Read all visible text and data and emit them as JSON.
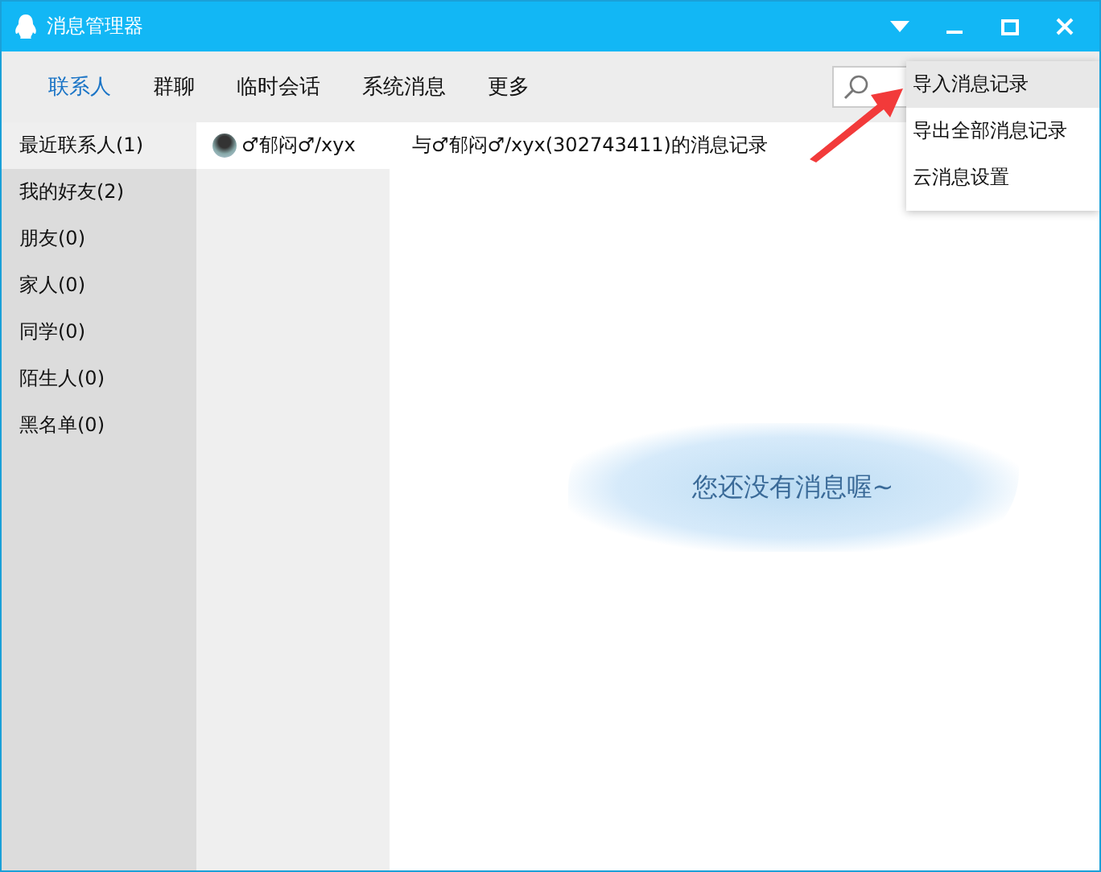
{
  "window": {
    "title": "消息管理器"
  },
  "tabs": [
    {
      "label": "联系人",
      "selected": true
    },
    {
      "label": "群聊",
      "selected": false
    },
    {
      "label": "临时会话",
      "selected": false
    },
    {
      "label": "系统消息",
      "selected": false
    },
    {
      "label": "更多",
      "selected": false
    }
  ],
  "menu": {
    "items": [
      {
        "label": "导入消息记录",
        "selected": true
      },
      {
        "label": "导出全部消息记录",
        "selected": false
      },
      {
        "label": "云消息设置",
        "selected": false
      }
    ]
  },
  "groups": [
    {
      "label": "最近联系人(1)",
      "selected": true
    },
    {
      "label": "我的好友(2)",
      "selected": false
    },
    {
      "label": "朋友(0)",
      "selected": false
    },
    {
      "label": "家人(0)",
      "selected": false
    },
    {
      "label": "同学(0)",
      "selected": false
    },
    {
      "label": "陌生人(0)",
      "selected": false
    },
    {
      "label": "黑名单(0)",
      "selected": false
    }
  ],
  "contacts": [
    {
      "name": "♂郁闷♂/xyx",
      "selected": true
    }
  ],
  "record": {
    "title": "与♂郁闷♂/xyx(302743411)的消息记录",
    "empty_message": "您还没有消息喔~"
  }
}
